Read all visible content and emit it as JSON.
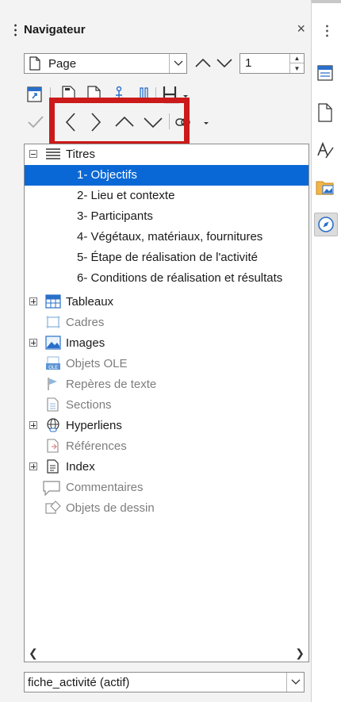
{
  "panel": {
    "title": "Navigateur",
    "close_glyph": "×"
  },
  "toolbar": {
    "category_select": "Page",
    "page_number": "1"
  },
  "tree": {
    "categories": [
      {
        "label": "Titres",
        "icon": "headings-icon",
        "expandable": true,
        "expanded": true,
        "dim": false
      },
      {
        "label": "Tableaux",
        "icon": "table-icon",
        "expandable": true,
        "expanded": false,
        "dim": false
      },
      {
        "label": "Cadres",
        "icon": "frame-icon",
        "expandable": false,
        "dim": true
      },
      {
        "label": "Images",
        "icon": "image-icon",
        "expandable": true,
        "expanded": false,
        "dim": false
      },
      {
        "label": "Objets OLE",
        "icon": "ole-icon",
        "expandable": false,
        "dim": true
      },
      {
        "label": "Repères de texte",
        "icon": "bookmark-icon",
        "expandable": false,
        "dim": true
      },
      {
        "label": "Sections",
        "icon": "section-icon",
        "expandable": false,
        "dim": true
      },
      {
        "label": "Hyperliens",
        "icon": "hyperlink-icon",
        "expandable": true,
        "expanded": false,
        "dim": false
      },
      {
        "label": "Références",
        "icon": "reference-icon",
        "expandable": false,
        "dim": true
      },
      {
        "label": "Index",
        "icon": "index-icon",
        "expandable": true,
        "expanded": false,
        "dim": false
      },
      {
        "label": "Commentaires",
        "icon": "comment-icon",
        "expandable": false,
        "dim": true
      },
      {
        "label": "Objets de dessin",
        "icon": "drawing-object-icon",
        "expandable": false,
        "dim": true
      }
    ],
    "headings": [
      {
        "label": "1- Objectifs",
        "selected": true
      },
      {
        "label": "2- Lieu et contexte",
        "selected": false
      },
      {
        "label": "3- Participants",
        "selected": false
      },
      {
        "label": "4- Végétaux, matériaux, fournitures",
        "selected": false
      },
      {
        "label": "5- Étape de réalisation de l'activité",
        "selected": false
      },
      {
        "label": "6- Conditions de réalisation et résultats",
        "selected": false
      }
    ]
  },
  "footer": {
    "document_select": "fiche_activité (actif)"
  },
  "colors": {
    "selection": "#0a68d6",
    "highlight_box": "#cc1a1a"
  }
}
